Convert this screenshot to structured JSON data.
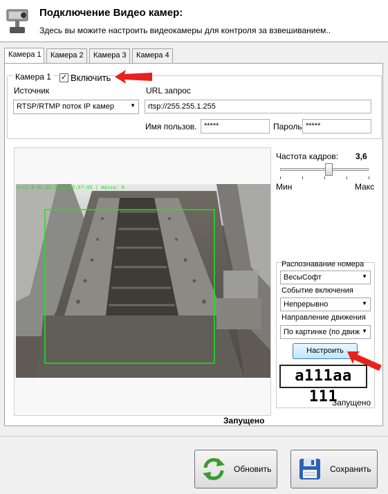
{
  "header": {
    "title": "Подключение Видео камер:",
    "subtitle": "Здесь вы можите настроить видеокамеры для контроля за взвешиванием.."
  },
  "tabs": [
    {
      "label": "Камера 1",
      "active": true
    },
    {
      "label": "Камера 2",
      "active": false
    },
    {
      "label": "Камера 3",
      "active": false
    },
    {
      "label": "Камера 4",
      "active": false
    }
  ],
  "camera": {
    "group_label": "Камера 1",
    "enable_label": "Включить",
    "enabled": true,
    "source_label": "Источник",
    "source_value": "RTSP/RTMP поток IP камер",
    "url_label": "URL запрос",
    "url_value": "rtsp://255.255.1.255",
    "user_label": "Имя пользов.",
    "user_value": "*****",
    "password_label": "Пароль",
    "password_value": "*****"
  },
  "video": {
    "overlay_text": "1=11.8 01.02.2016 15:57:45 | massa:     0",
    "status": "Запущено"
  },
  "frame_rate": {
    "label": "Частота кадров:",
    "value": "3,6",
    "min_label": "Мин",
    "max_label": "Макс",
    "slider_fraction": 0.55
  },
  "recognition": {
    "number_label": "Распознавание номера",
    "number_value": "ВесыСофт",
    "event_label": "Событие включения",
    "event_value": "Непрерывно",
    "direction_label": "Направление движения",
    "direction_value": "По картинке (по движ",
    "configure_button": "Настроить",
    "plate_text": "a111aa 111",
    "status": "Запущено"
  },
  "buttons": {
    "refresh": "Обновить",
    "save": "Сохранить"
  },
  "colors": {
    "arrow": "#e8201c",
    "overlay_green": "#19e619",
    "button_blue": "#3c7fb1"
  }
}
